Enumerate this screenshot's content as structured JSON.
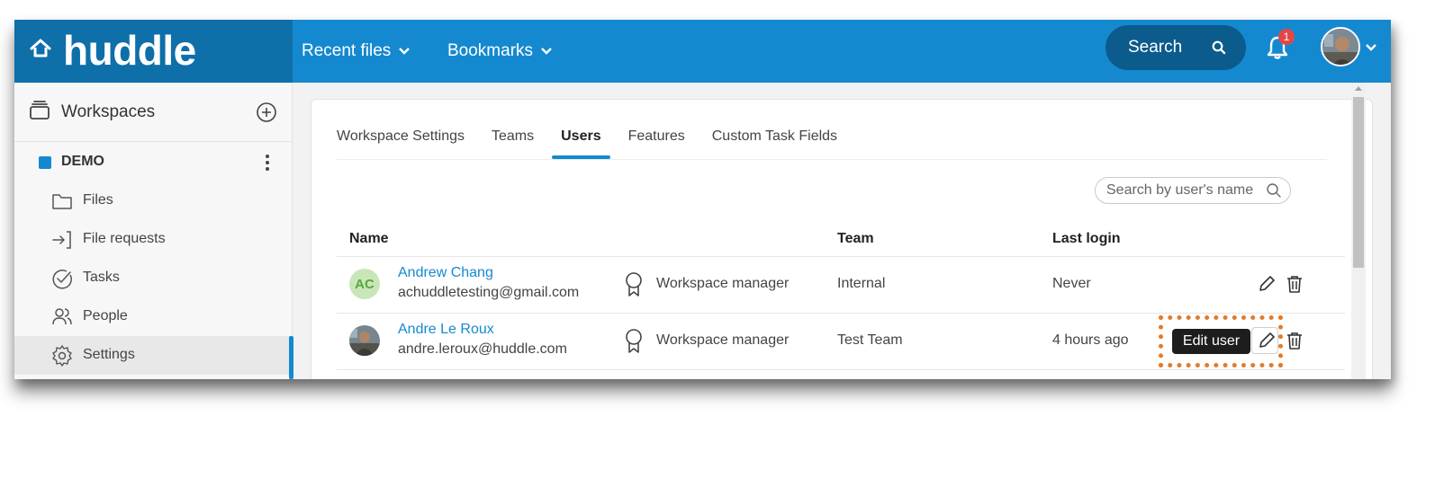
{
  "header": {
    "logo": "huddle",
    "nav": [
      {
        "label": "Recent files"
      },
      {
        "label": "Bookmarks"
      }
    ],
    "search_label": "Search",
    "notification_count": "1",
    "brand_color": "#1589d0"
  },
  "sidebar": {
    "workspaces_label": "Workspaces",
    "workspace_name": "DEMO",
    "items": [
      {
        "label": "Files",
        "icon": "folder-icon"
      },
      {
        "label": "File requests",
        "icon": "file-request-icon"
      },
      {
        "label": "Tasks",
        "icon": "check-circle-icon"
      },
      {
        "label": "People",
        "icon": "people-icon"
      },
      {
        "label": "Settings",
        "icon": "gear-icon",
        "active": true
      }
    ]
  },
  "settings": {
    "tabs": [
      {
        "label": "Workspace Settings"
      },
      {
        "label": "Teams"
      },
      {
        "label": "Users",
        "active": true
      },
      {
        "label": "Features"
      },
      {
        "label": "Custom Task Fields"
      }
    ],
    "search_placeholder": "Search by user's name",
    "columns": {
      "name": "Name",
      "team": "Team",
      "last_login": "Last login"
    },
    "users": [
      {
        "initials": "AC",
        "name": "Andrew Chang",
        "email": "achuddletesting@gmail.com",
        "role": "Workspace manager",
        "team": "Internal",
        "last_login": "Never"
      },
      {
        "initials": "",
        "name": "Andre Le Roux",
        "email": "andre.leroux@huddle.com",
        "role": "Workspace manager",
        "team": "Test Team",
        "last_login": "4 hours ago"
      }
    ],
    "tooltip": "Edit user",
    "highlight_color": "#e27b29"
  }
}
